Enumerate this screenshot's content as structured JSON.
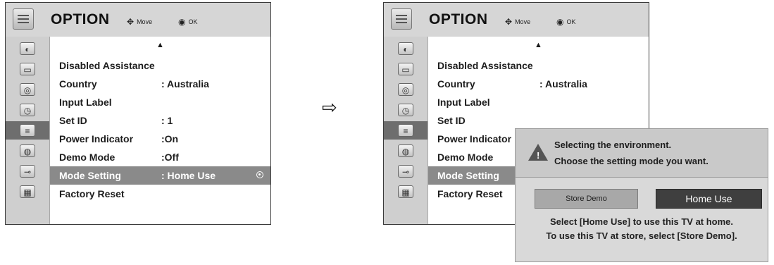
{
  "menu": {
    "title": "OPTION",
    "hint_move": "Move",
    "hint_ok": "OK",
    "scroll_up": "▲",
    "items": [
      {
        "label": "Disabled Assistance",
        "value": ""
      },
      {
        "label": "Country",
        "value": ": Australia"
      },
      {
        "label": "Input Label",
        "value": ""
      },
      {
        "label": "Set ID",
        "value": ": 1"
      },
      {
        "label": "Power Indicator",
        "value": ":On"
      },
      {
        "label": "Demo Mode",
        "value": ":Off"
      },
      {
        "label": "Mode Setting",
        "value": ": Home Use"
      },
      {
        "label": "Factory Reset",
        "value": ""
      }
    ]
  },
  "sidebar_icons": [
    "satellite-icon",
    "picture-icon",
    "audio-icon",
    "time-icon",
    "option-icon",
    "lock-icon",
    "input-icon",
    "media-icon"
  ],
  "transition_arrow": "⇨",
  "dialog": {
    "title_line1": "Selecting the environment.",
    "title_line2": "Choose the setting mode you want.",
    "store_demo": "Store Demo",
    "home_use": "Home Use",
    "message_line1": "Select [Home Use] to use this TV at home.",
    "message_line2": "To use this TV at store, select [Store Demo]."
  }
}
